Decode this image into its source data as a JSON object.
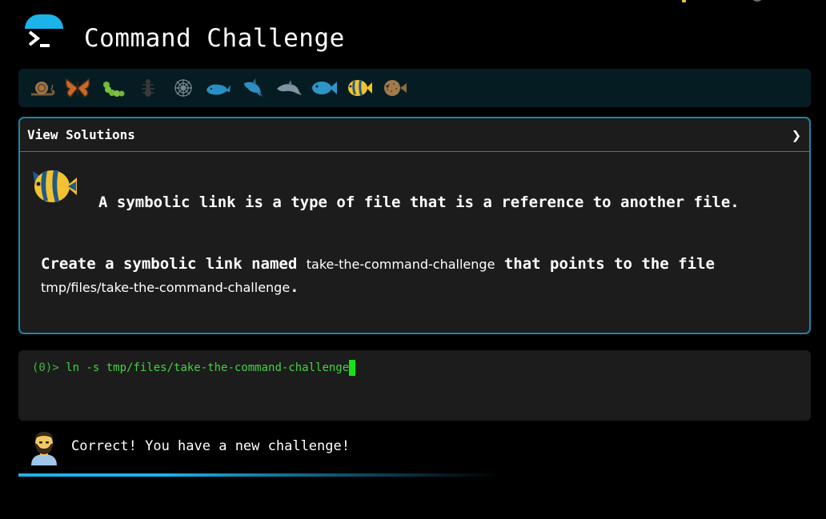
{
  "header": {
    "title": "Command Challenge",
    "logo_icon": "terminal-prompt-icon"
  },
  "creatures": [
    {
      "name": "snail",
      "icon": "snail-icon"
    },
    {
      "name": "butterfly",
      "icon": "butterfly-icon"
    },
    {
      "name": "caterpillar",
      "icon": "caterpillar-icon"
    },
    {
      "name": "ant",
      "icon": "ant-icon"
    },
    {
      "name": "spider-web",
      "icon": "spider-web-icon"
    },
    {
      "name": "whale",
      "icon": "whale-icon"
    },
    {
      "name": "shark",
      "icon": "shark-icon"
    },
    {
      "name": "dolphin",
      "icon": "dolphin-icon"
    },
    {
      "name": "fish",
      "icon": "fish-icon"
    },
    {
      "name": "tropical-fish",
      "icon": "tropical-fish-icon"
    },
    {
      "name": "blowfish",
      "icon": "blowfish-icon"
    }
  ],
  "panel": {
    "header_label": "View Solutions",
    "chevron": "❯",
    "intro": "A symbolic link is a type of file that is a reference to another file.",
    "task_prefix": "Create a symbolic link named ",
    "task_code1": "take-the-command-challenge",
    "task_middle": " that points to the file ",
    "task_code2": "tmp/files/take-the-command-challenge",
    "task_suffix": "."
  },
  "terminal": {
    "prompt": "(0)> ",
    "command": "ln -s tmp/files/take-the-command-challenge"
  },
  "feedback": {
    "message": "Correct! You have a new challenge!",
    "avatar_icon": "man-beard-icon"
  },
  "colors": {
    "accent": "#1cb3ea",
    "panel_border": "#1b86a8",
    "terminal_green": "#44d044",
    "cursor_green": "#16e316"
  }
}
